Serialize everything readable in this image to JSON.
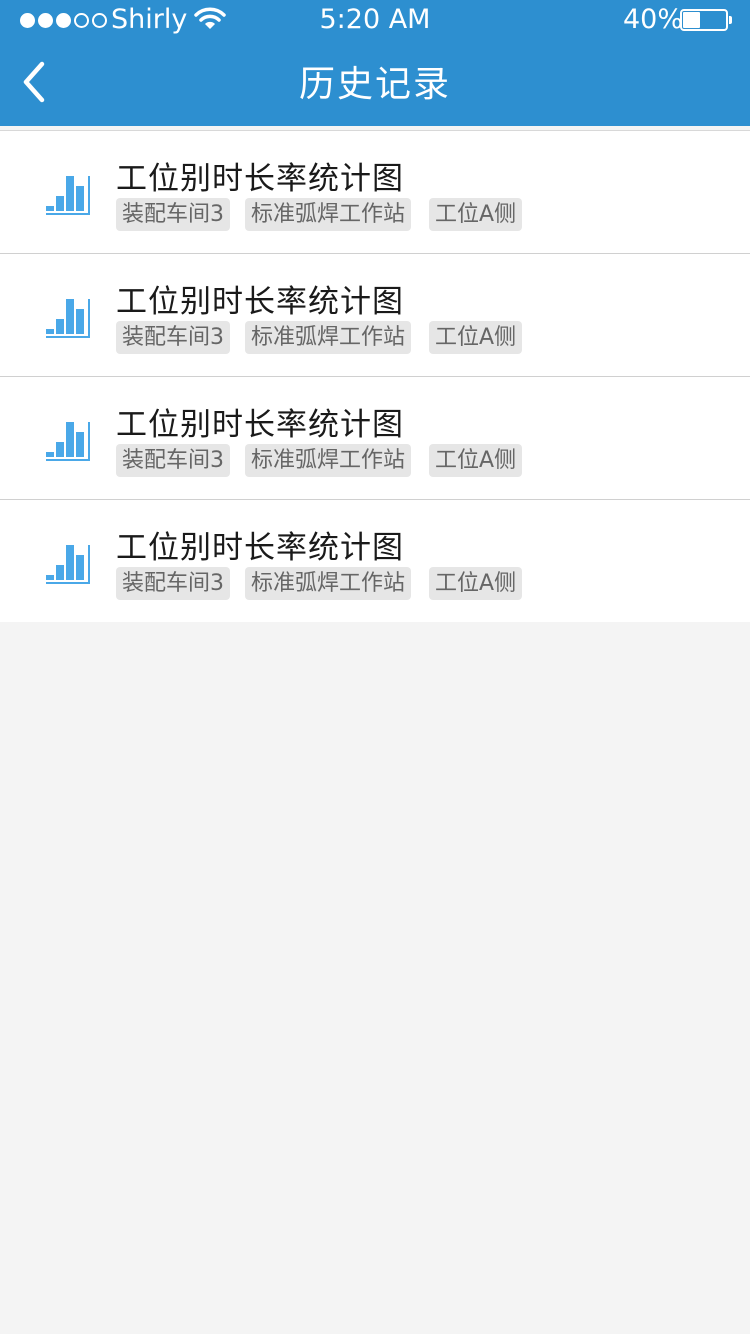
{
  "status_bar": {
    "carrier": "Shirly",
    "time": "5:20 AM",
    "battery_percent": "40%",
    "battery_level": 0.4,
    "signal_bars_filled": 3,
    "signal_bars_total": 5
  },
  "nav": {
    "title": "历史记录",
    "back_icon": "chevron-left-icon"
  },
  "colors": {
    "header_bg": "#2d8fd0",
    "chart_icon": "#4aa8e8",
    "page_bg": "#f4f4f4"
  },
  "records": [
    {
      "icon": "bar-chart-icon",
      "title": "工位别时长率统计图",
      "tags": [
        "装配车间3",
        "标准弧焊工作站",
        "工位A侧"
      ]
    },
    {
      "icon": "bar-chart-icon",
      "title": "工位别时长率统计图",
      "tags": [
        "装配车间3",
        "标准弧焊工作站",
        "工位A侧"
      ]
    },
    {
      "icon": "bar-chart-icon",
      "title": "工位别时长率统计图",
      "tags": [
        "装配车间3",
        "标准弧焊工作站",
        "工位A侧"
      ]
    },
    {
      "icon": "bar-chart-icon",
      "title": "工位别时长率统计图",
      "tags": [
        "装配车间3",
        "标准弧焊工作站",
        "工位A侧"
      ]
    }
  ]
}
